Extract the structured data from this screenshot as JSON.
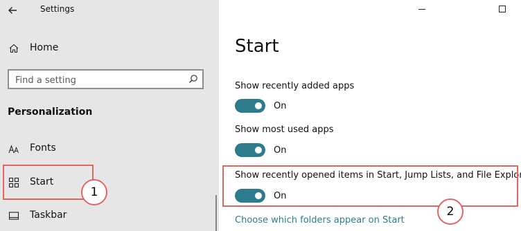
{
  "window": {
    "title": "Settings",
    "back_icon": "arrow-left-icon",
    "minimize_icon": "minimize-icon",
    "maximize_icon": "maximize-icon"
  },
  "sidebar": {
    "home": {
      "label": "Home",
      "icon": "home-icon"
    },
    "search": {
      "placeholder": "Find a setting",
      "value": "",
      "icon": "search-icon"
    },
    "section_title": "Personalization",
    "items": [
      {
        "label": "Fonts",
        "icon": "fonts-icon",
        "selected": false
      },
      {
        "label": "Start",
        "icon": "start-icon",
        "selected": true
      },
      {
        "label": "Taskbar",
        "icon": "taskbar-icon",
        "selected": false
      }
    ]
  },
  "main": {
    "title": "Start",
    "settings": [
      {
        "label": "Show recently added apps",
        "state": "On",
        "on": true
      },
      {
        "label": "Show most used apps",
        "state": "On",
        "on": true
      },
      {
        "label": "Show recently opened items in Start, Jump Lists, and File Explorer",
        "state": "On",
        "on": true
      }
    ],
    "link": "Choose which folders appear on Start"
  },
  "annotations": {
    "callout_1": "1",
    "callout_2": "2",
    "color": "#e06666"
  },
  "colors": {
    "accent": "#2d7c8d",
    "sidebar_bg": "#e6e6e6",
    "main_bg": "#ffffff"
  }
}
